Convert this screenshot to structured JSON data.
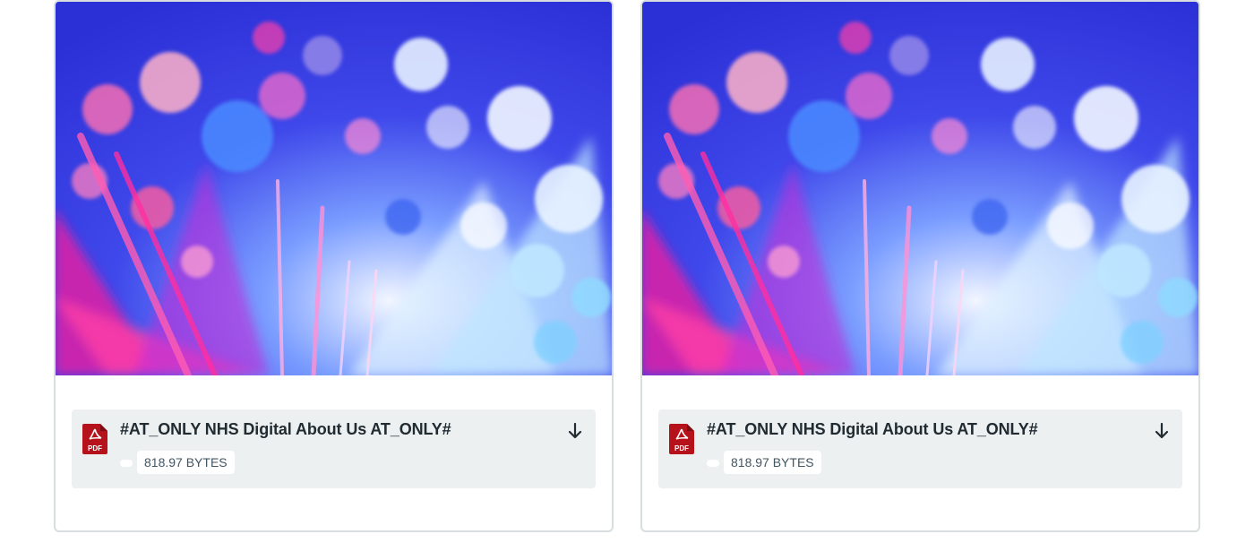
{
  "cards": [
    {
      "image": {
        "description_icon": "fiber-optic-lights-image"
      },
      "attachment": {
        "file_type_icon": "pdf-icon",
        "title": "#AT_ONLY NHS Digital About Us AT_ONLY#",
        "size": "818.97 BYTES",
        "download_icon": "arrow-down-icon"
      }
    },
    {
      "image": {
        "description_icon": "fiber-optic-lights-image"
      },
      "attachment": {
        "file_type_icon": "pdf-icon",
        "title": "#AT_ONLY NHS Digital About Us AT_ONLY#",
        "size": "818.97 BYTES",
        "download_icon": "arrow-down-icon"
      }
    }
  ],
  "colors": {
    "card_border": "#d8dde0",
    "attachment_bg": "#edf0f1",
    "title_text": "#212b32",
    "meta_text": "#425563",
    "pdf_red": "#b5121b"
  }
}
